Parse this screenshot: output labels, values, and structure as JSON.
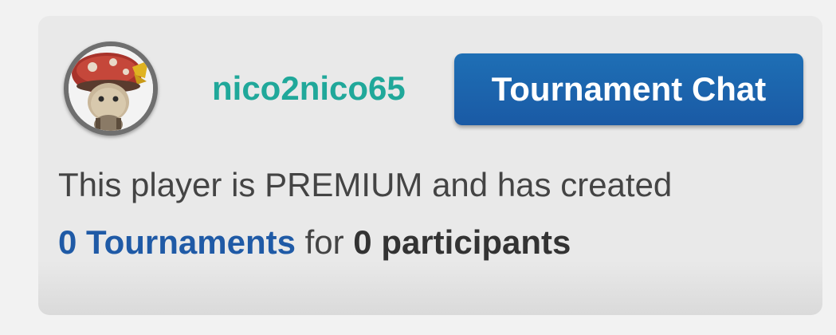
{
  "profile": {
    "username": "nico2nico65",
    "chat_button_label": "Tournament Chat",
    "description_line1": "This player is PREMIUM and has created",
    "tournaments_count_text": "0 Tournaments",
    "for_text": "for",
    "participants_text": "0 participants"
  },
  "colors": {
    "username": "#20a89a",
    "button": "#1a5aa5",
    "link": "#1f5aa6",
    "card_background": "#e9e9e9"
  },
  "icons": {
    "avatar": "mushroom-hat-character-avatar"
  }
}
